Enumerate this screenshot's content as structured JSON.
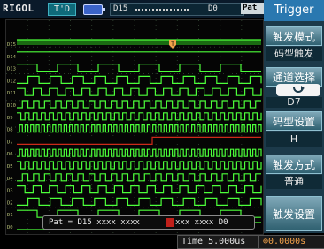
{
  "top_bar": {
    "brand": "RIGOL",
    "run_state": "T'D",
    "trigger_source": "D15",
    "trigger_target": "D0",
    "trigger_type": "Pat"
  },
  "waveform": {
    "channels": [
      "D15",
      "D14",
      "D13",
      "D12",
      "D11",
      "D10",
      "D9",
      "D8",
      "D7",
      "D6",
      "D5",
      "D4",
      "D3",
      "D2",
      "D1",
      "D0"
    ],
    "selected_channel": "D7",
    "pattern_status": "Pat = D15 xxxx xxxx ",
    "pattern_status_tail": "xxx xxxx D0",
    "colors": {
      "trace": "#4cff3a",
      "selected": "#cc2a1a",
      "grid": "#2a3a2a"
    }
  },
  "bottom_bar": {
    "timebase": "Time 5.000us",
    "trigger_pos": "0.0000s"
  },
  "menu": {
    "title": "Trigger",
    "items": [
      {
        "label": "触发模式",
        "value": "码型触发"
      },
      {
        "label": "通道选择",
        "value": "D7"
      },
      {
        "label": "码型设置",
        "value": "H"
      },
      {
        "label": "触发方式",
        "value": "普通"
      },
      {
        "label": "触发设置",
        "value": ""
      }
    ]
  }
}
